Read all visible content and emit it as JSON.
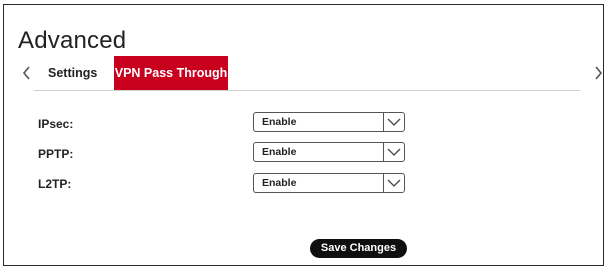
{
  "page": {
    "title": "Advanced"
  },
  "nav": {
    "prev_icon": "chevron-left-icon",
    "next_icon": "chevron-right-icon"
  },
  "tabs": [
    {
      "label": "Settings",
      "active": false
    },
    {
      "label": "VPN Pass Through",
      "active": true,
      "color": "#c8001e"
    }
  ],
  "fields": [
    {
      "label": "IPsec:",
      "value": "Enable"
    },
    {
      "label": "PPTP:",
      "value": "Enable"
    },
    {
      "label": "L2TP:",
      "value": "Enable"
    }
  ],
  "actions": {
    "save_label": "Save Changes"
  }
}
